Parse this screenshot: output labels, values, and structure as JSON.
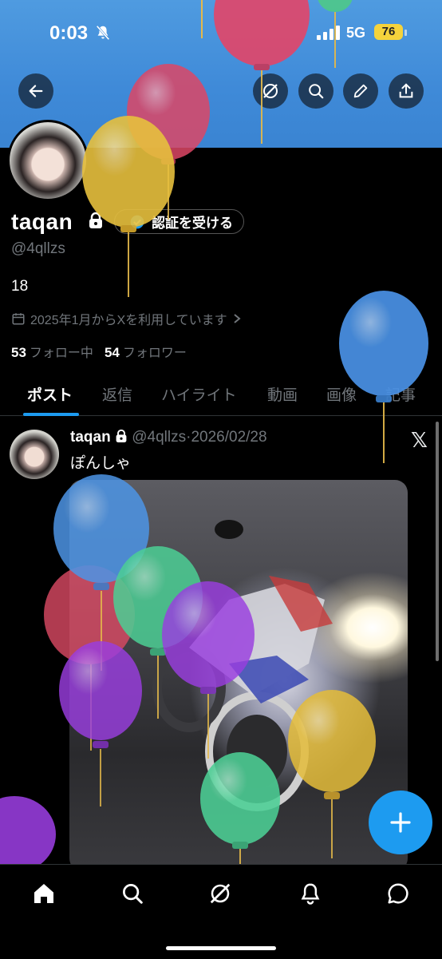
{
  "status_bar": {
    "time": "0:03",
    "network": "5G",
    "battery": "76"
  },
  "profile": {
    "name": "taqan",
    "handle": "@4qllzs",
    "verify_label": "認証を受ける",
    "bio": "18",
    "joined": "2025年1月からXを利用しています",
    "following_count": "53",
    "following_label": "フォロー中",
    "followers_count": "54",
    "followers_label": "フォロワー"
  },
  "tabs": [
    "ポスト",
    "返信",
    "ハイライト",
    "動画",
    "画像",
    "記事"
  ],
  "post": {
    "name": "taqan",
    "handle": "@4qllzs",
    "date": "2026/02/28",
    "text": "ぽんしゃ"
  },
  "colors": {
    "accent": "#1d9bf0",
    "banner": "#4a94dd",
    "background": "#000000",
    "muted": "#71767b"
  },
  "icons": [
    "back-arrow-icon",
    "grok-icon",
    "search-icon",
    "edit-icon",
    "share-icon",
    "lock-icon",
    "verified-badge-icon",
    "calendar-icon",
    "x-logo-icon",
    "plus-icon",
    "home-icon",
    "notifications-icon",
    "messages-icon"
  ]
}
